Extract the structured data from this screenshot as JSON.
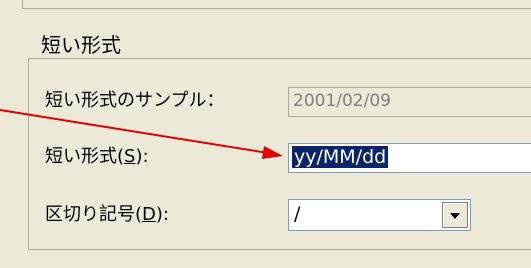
{
  "group": {
    "title": "短い形式",
    "sample_label": "短い形式のサンプル：",
    "sample_value": "2001/02/09",
    "format_label_prefix": "短い形式(",
    "format_label_key": "S",
    "format_label_suffix": "):",
    "format_value": "yy/MM/dd",
    "separator_label_prefix": "区切り記号(",
    "separator_label_key": "D",
    "separator_label_suffix": "):",
    "separator_value": "/"
  },
  "colors": {
    "annotation_arrow": "#e00000",
    "selection": "#0a246a"
  },
  "icons": {
    "dropdown": "chevron-down-icon"
  }
}
